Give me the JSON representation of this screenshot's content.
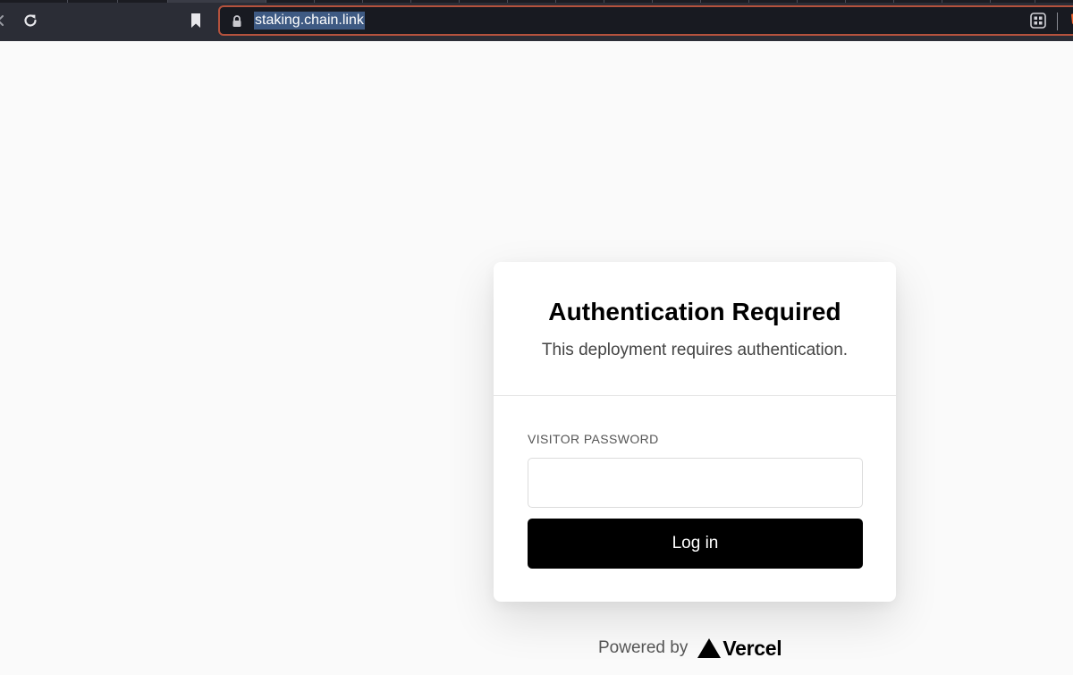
{
  "browser": {
    "url": "staking.chain.link"
  },
  "card": {
    "title": "Authentication Required",
    "subtitle": "This deployment requires authentication.",
    "password_label": "VISITOR PASSWORD",
    "password_value": "",
    "login_label": "Log in"
  },
  "footer": {
    "powered_by": "Powered by",
    "brand": "Vercel"
  },
  "colors": {
    "chrome_bg": "#2b2d36",
    "omnibox_border": "#b4523d",
    "url_highlight": "#3e5a83",
    "page_bg": "#fafafa",
    "button_bg": "#000000"
  },
  "icons": [
    "back-icon",
    "reload-icon",
    "bookmark-icon",
    "lock-icon",
    "qr-code-icon",
    "brave-shield-icon",
    "vercel-logo-icon"
  ]
}
